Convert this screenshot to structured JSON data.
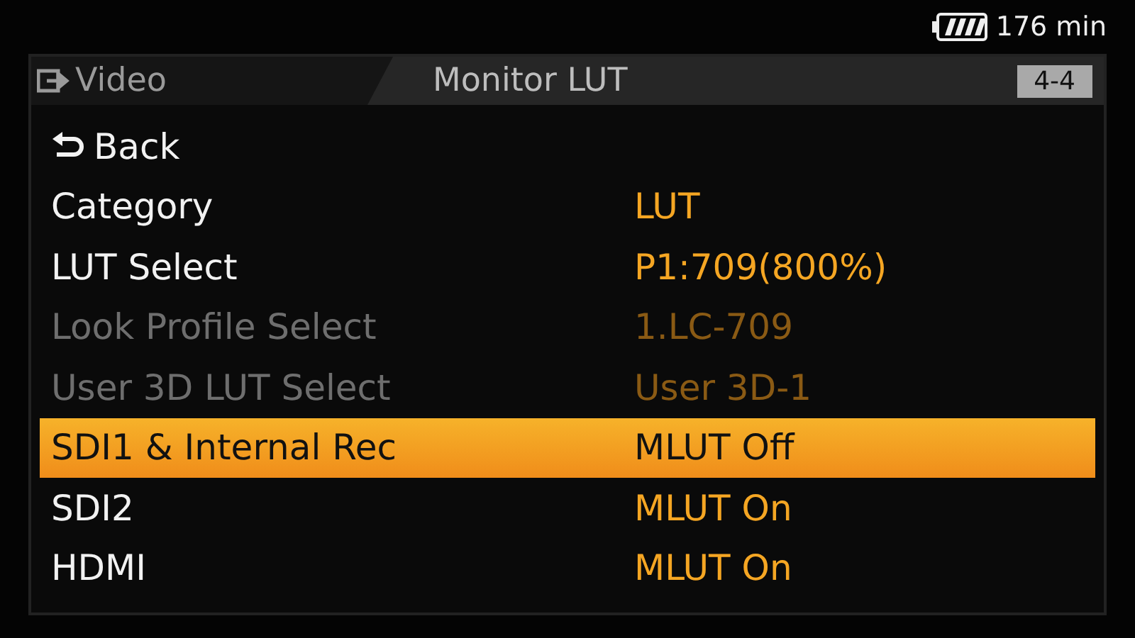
{
  "status_bar": {
    "remaining": "176 min"
  },
  "header": {
    "parent": "Video",
    "title": "Monitor LUT",
    "page": "4-4"
  },
  "menu_items": [
    {
      "kind": "back",
      "label": "Back",
      "selected": false,
      "disabled": false
    },
    {
      "kind": "setting",
      "label": "Category",
      "value": "LUT",
      "selected": false,
      "disabled": false
    },
    {
      "kind": "setting",
      "label": "LUT Select",
      "value": "P1:709(800%)",
      "selected": false,
      "disabled": false
    },
    {
      "kind": "setting",
      "label": "Look Profile Select",
      "value": "1.LC-709",
      "selected": false,
      "disabled": true
    },
    {
      "kind": "setting",
      "label": "User 3D LUT Select",
      "value": "User 3D-1",
      "selected": false,
      "disabled": true
    },
    {
      "kind": "setting",
      "label": "SDI1 & Internal Rec",
      "value": "MLUT Off",
      "selected": true,
      "disabled": false
    },
    {
      "kind": "setting",
      "label": "SDI2",
      "value": "MLUT On",
      "selected": false,
      "disabled": false
    },
    {
      "kind": "setting",
      "label": "HDMI",
      "value": "MLUT On",
      "selected": false,
      "disabled": false
    }
  ]
}
